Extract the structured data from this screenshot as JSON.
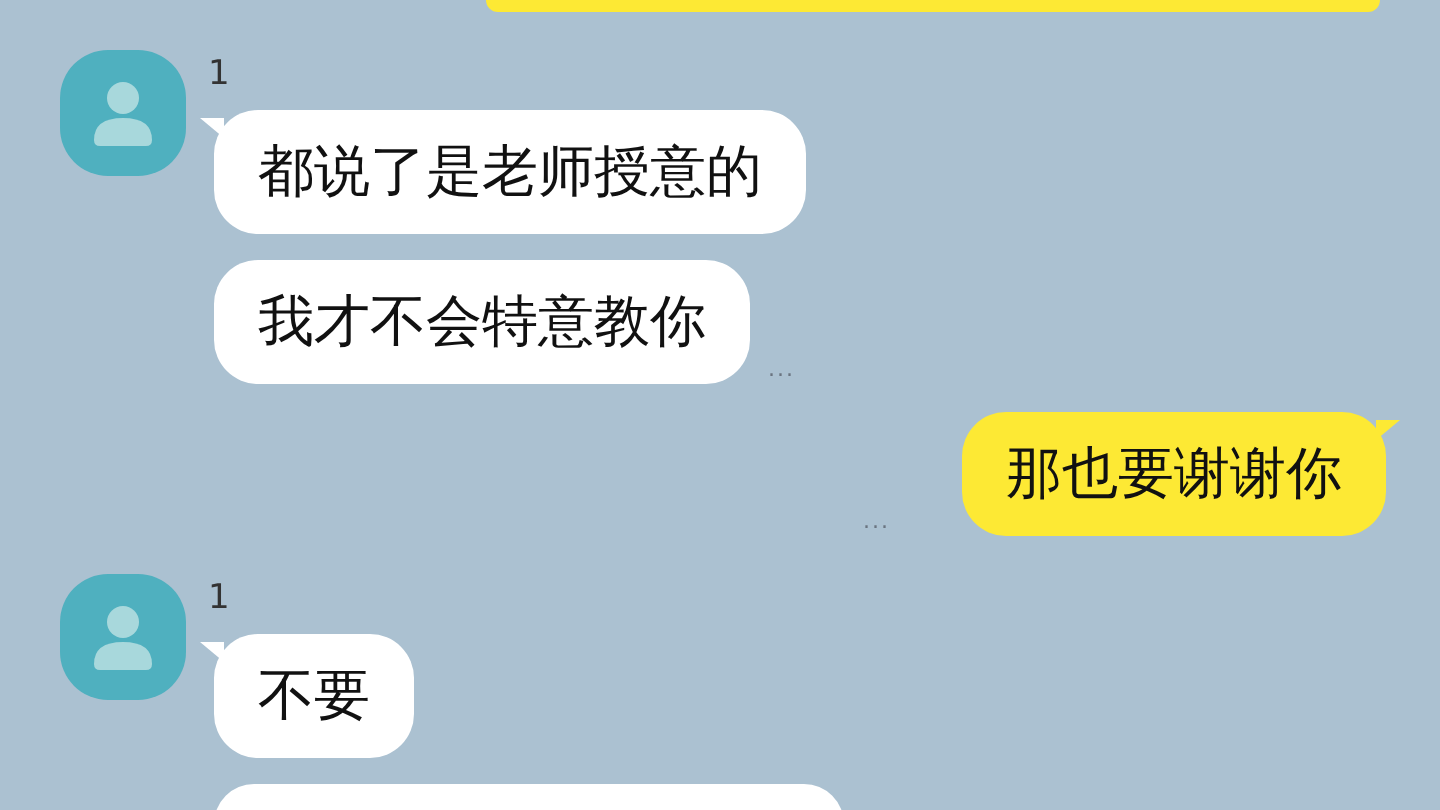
{
  "conversation": [
    {
      "kind": "incoming",
      "sender": "1",
      "messages": [
        "都说了是老师授意的",
        "我才不会特意教你"
      ],
      "status": "..."
    },
    {
      "kind": "outgoing",
      "messages": [
        "那也要谢谢你"
      ],
      "status": "..."
    },
    {
      "kind": "incoming",
      "sender": "1",
      "messages": [
        "不要"
      ]
    }
  ]
}
